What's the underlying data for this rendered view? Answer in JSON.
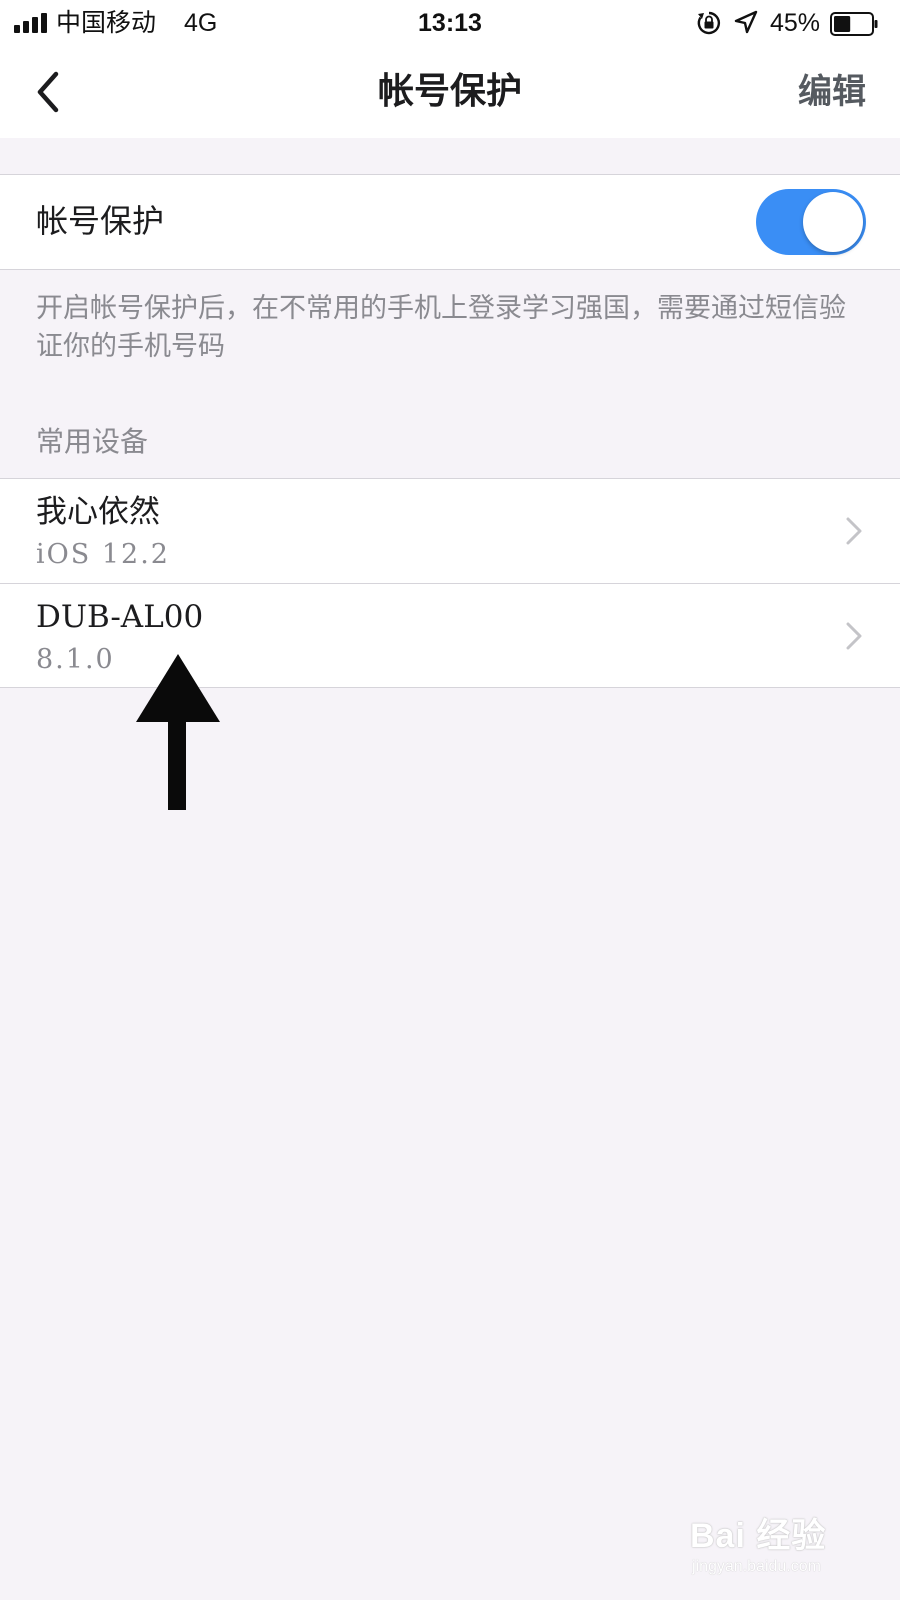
{
  "status_bar": {
    "carrier": "中国移动",
    "network": "4G",
    "time": "13:13",
    "battery_percent": "45%",
    "battery_level": 0.45,
    "icons": [
      "signal-icon",
      "rotation-lock-icon",
      "location-icon",
      "battery-icon"
    ]
  },
  "nav": {
    "back_icon": "chevron-left-icon",
    "title": "帐号保护",
    "edit_label": "编辑"
  },
  "protection": {
    "label": "帐号保护",
    "enabled": true,
    "toggle_color": "#3a8ef5",
    "description": "开启帐号保护后，在不常用的手机上登录学习强国，需要通过短信验证你的手机号码"
  },
  "devices_section": {
    "header": "常用设备",
    "items": [
      {
        "name": "我心依然",
        "os": "iOS 12.2"
      },
      {
        "name": "DUB-AL00",
        "os": "8.1.0"
      }
    ],
    "row_icon": "chevron-right-icon"
  },
  "annotation": {
    "icon": "up-arrow-icon"
  },
  "watermark": {
    "main": "Bai 经验",
    "sub": "jingyan.baidu.com"
  }
}
